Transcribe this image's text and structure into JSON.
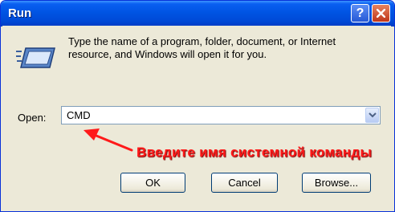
{
  "window": {
    "title": "Run"
  },
  "titlebar": {
    "help_label": "?",
    "close_icon": "close-icon"
  },
  "dialog": {
    "description": "Type the name of a program, folder, document, or Internet resource, and Windows will open it for you.",
    "run_icon": "run-icon",
    "open_label": "Open:",
    "open_value": "CMD",
    "annotation": "Введите имя системной команды"
  },
  "buttons": {
    "ok": "OK",
    "cancel": "Cancel",
    "browse": "Browse..."
  },
  "colors": {
    "titlebar": "#0054e3",
    "dialog_bg": "#ece9d8",
    "annotation": "#ff1a1a",
    "close": "#c0361a"
  }
}
